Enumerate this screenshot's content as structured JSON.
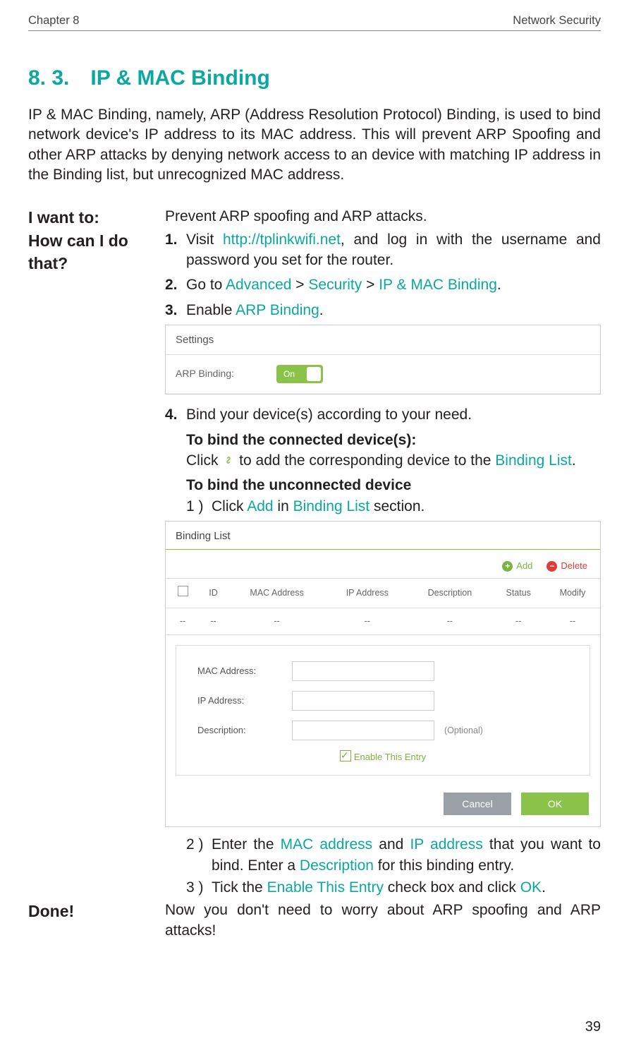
{
  "header": {
    "chapter": "Chapter 8",
    "section_name": "Network Security"
  },
  "title": {
    "number": "8. 3.",
    "text": "IP & MAC Binding"
  },
  "intro": "IP & MAC Binding, namely, ARP (Address Resolution Protocol) Binding, is used to bind network device's IP address to its MAC address. This will prevent ARP Spoofing and other ARP attacks by denying network access to an device with matching IP address in the Binding list, but unrecognized MAC address.",
  "labels": {
    "want": "I want to:",
    "how": "How can I do that?",
    "done": "Done!"
  },
  "want_text": "Prevent ARP spoofing and ARP attacks.",
  "steps": {
    "s1": {
      "n": "1.",
      "pre": "Visit ",
      "link": "http://tplinkwifi.net",
      "post": ", and log in with the username and password you set for the router."
    },
    "s2": {
      "n": "2.",
      "pre": "Go to ",
      "a": "Advanced",
      "sep1": " > ",
      "b": "Security",
      "sep2": " > ",
      "c": "IP & MAC Binding",
      "end": "."
    },
    "s3": {
      "n": "3.",
      "pre": "Enable ",
      "a": "ARP Binding",
      "end": "."
    },
    "s4": {
      "n": "4.",
      "text": "Bind your device(s) according to your need."
    }
  },
  "sub": {
    "h1": "To bind the connected device(s):",
    "click_pre": "Click ",
    "click_icon_name": "link-icon",
    "click_mid": " to add the corresponding device to the ",
    "click_link": "Binding List",
    "click_end": ".",
    "h2": "To bind the unconnected device",
    "u1": {
      "n": "1 )",
      "pre": "Click ",
      "a": "Add",
      "mid": " in ",
      "b": "Binding List",
      "end": " section."
    },
    "u2": {
      "n": "2 )",
      "pre": "Enter the ",
      "a": "MAC address",
      "mid1": " and ",
      "b": "IP address",
      "mid2": " that you want to bind. Enter a ",
      "c": "Description",
      "end": " for this binding entry."
    },
    "u3": {
      "n": "3 )",
      "pre": "Tick the ",
      "a": "Enable This Entry",
      "mid": " check box and click ",
      "b": "OK",
      "end": "."
    }
  },
  "done_text": "Now you don't need to worry about ARP spoofing and ARP attacks!",
  "shot1": {
    "header": "Settings",
    "label": "ARP Binding:",
    "toggle": "On"
  },
  "shot2": {
    "header": "Binding List",
    "add": "Add",
    "delete": "Delete",
    "cols": {
      "id": "ID",
      "mac": "MAC Address",
      "ip": "IP Address",
      "desc": "Description",
      "status": "Status",
      "modify": "Modify"
    },
    "empty": "--",
    "form": {
      "mac": "MAC Address:",
      "ip": "IP Address:",
      "desc": "Description:",
      "optional": "(Optional)",
      "enable": "Enable This Entry",
      "cancel": "Cancel",
      "ok": "OK"
    }
  },
  "page_number": "39"
}
